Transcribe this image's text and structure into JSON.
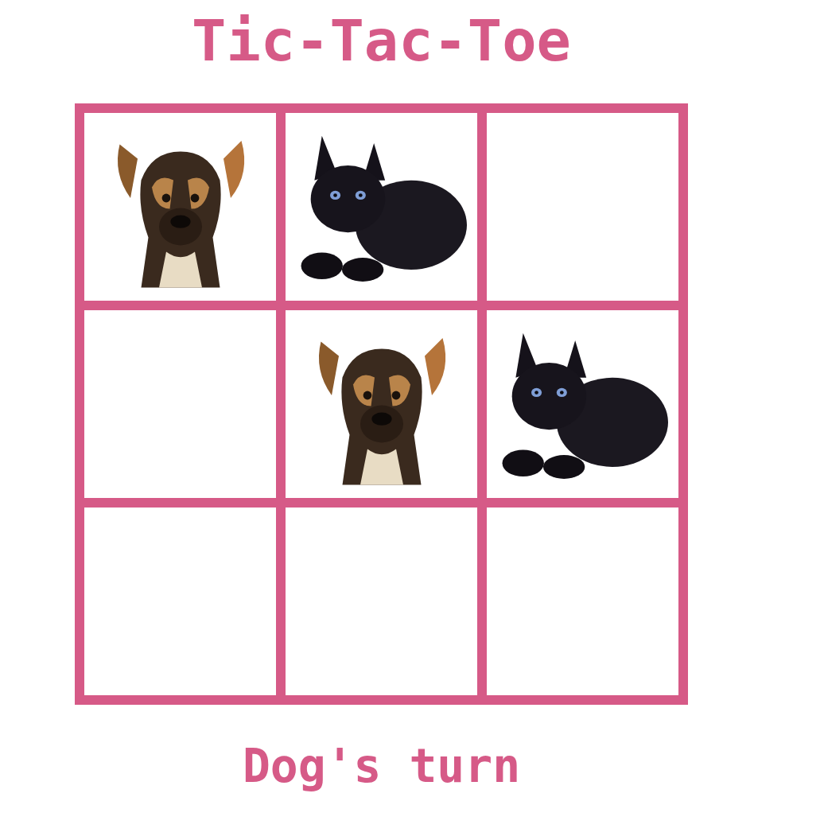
{
  "title": "Tic-Tac-Toe",
  "board": {
    "rows": [
      [
        {
          "kind": "dog"
        },
        {
          "kind": "cat"
        },
        {
          "kind": "empty"
        }
      ],
      [
        {
          "kind": "empty"
        },
        {
          "kind": "dog"
        },
        {
          "kind": "cat"
        }
      ],
      [
        {
          "kind": "empty"
        },
        {
          "kind": "empty"
        },
        {
          "kind": "empty"
        }
      ]
    ]
  },
  "status": "Dog's turn"
}
